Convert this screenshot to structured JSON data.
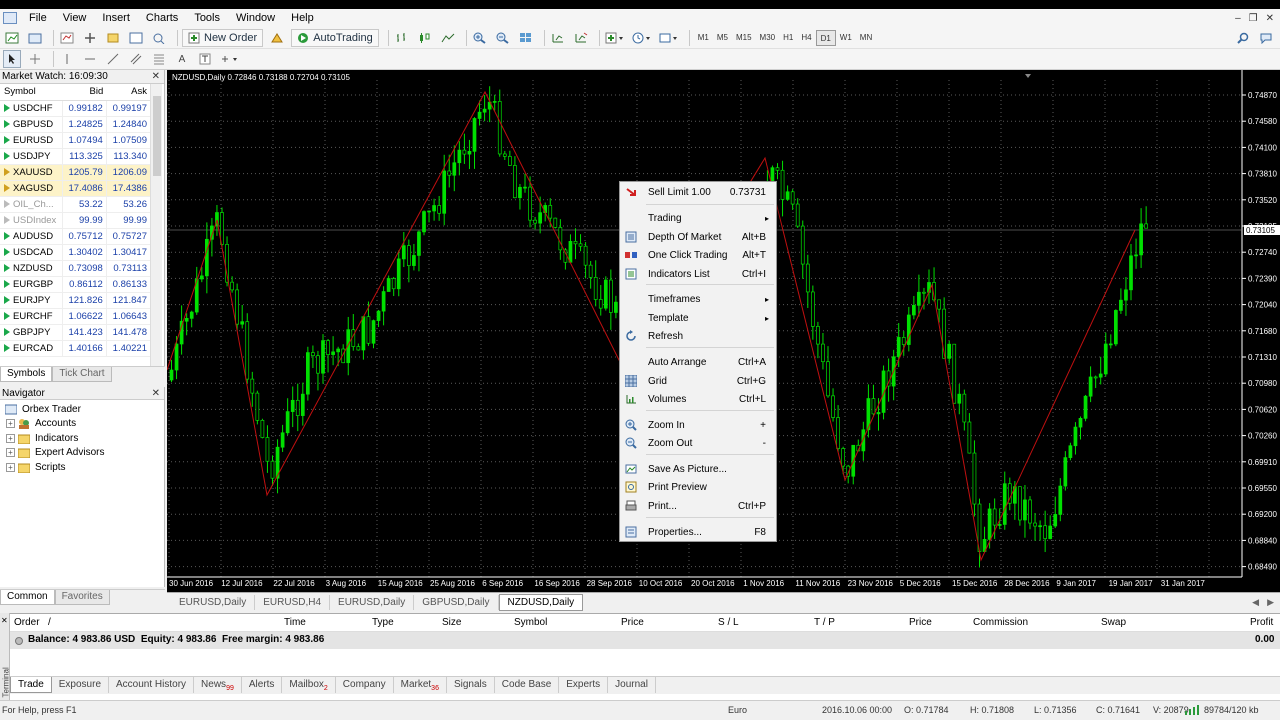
{
  "menu": {
    "items": [
      "File",
      "View",
      "Insert",
      "Charts",
      "Tools",
      "Window",
      "Help"
    ]
  },
  "toolbar": {
    "new_order": "New Order",
    "autotrading": "AutoTrading",
    "timeframes": [
      "M1",
      "M5",
      "M15",
      "M30",
      "H1",
      "H4",
      "D1",
      "W1",
      "MN"
    ],
    "selected_timeframe": "D1"
  },
  "market_watch": {
    "title": "Market Watch: 16:09:30",
    "columns": [
      "Symbol",
      "Bid",
      "Ask"
    ],
    "rows": [
      {
        "symbol": "USDCHF",
        "bid": "0.99182",
        "ask": "0.99197",
        "state": "normal"
      },
      {
        "symbol": "GBPUSD",
        "bid": "1.24825",
        "ask": "1.24840",
        "state": "normal"
      },
      {
        "symbol": "EURUSD",
        "bid": "1.07494",
        "ask": "1.07509",
        "state": "normal"
      },
      {
        "symbol": "USDJPY",
        "bid": "113.325",
        "ask": "113.340",
        "state": "normal"
      },
      {
        "symbol": "XAUUSD",
        "bid": "1205.79",
        "ask": "1206.09",
        "state": "highlight"
      },
      {
        "symbol": "XAGUSD",
        "bid": "17.4086",
        "ask": "17.4386",
        "state": "highlight"
      },
      {
        "symbol": "OIL_Ch...",
        "bid": "53.22",
        "ask": "53.26",
        "state": "dim"
      },
      {
        "symbol": "USDIndex",
        "bid": "99.99",
        "ask": "99.99",
        "state": "dim"
      },
      {
        "symbol": "AUDUSD",
        "bid": "0.75712",
        "ask": "0.75727",
        "state": "normal"
      },
      {
        "symbol": "USDCAD",
        "bid": "1.30402",
        "ask": "1.30417",
        "state": "normal"
      },
      {
        "symbol": "NZDUSD",
        "bid": "0.73098",
        "ask": "0.73113",
        "state": "normal"
      },
      {
        "symbol": "EURGBP",
        "bid": "0.86112",
        "ask": "0.86133",
        "state": "normal"
      },
      {
        "symbol": "EURJPY",
        "bid": "121.826",
        "ask": "121.847",
        "state": "normal"
      },
      {
        "symbol": "EURCHF",
        "bid": "1.06622",
        "ask": "1.06643",
        "state": "normal"
      },
      {
        "symbol": "GBPJPY",
        "bid": "141.423",
        "ask": "141.478",
        "state": "normal"
      },
      {
        "symbol": "EURCAD",
        "bid": "1.40166",
        "ask": "1.40221",
        "state": "normal"
      }
    ],
    "tabs": [
      "Symbols",
      "Tick Chart"
    ]
  },
  "navigator": {
    "title": "Navigator",
    "root": "Orbex Trader",
    "items": [
      "Accounts",
      "Indicators",
      "Expert Advisors",
      "Scripts"
    ],
    "tabs": [
      "Common",
      "Favorites"
    ]
  },
  "chart": {
    "title": "NZDUSD,Daily  0.72846 0.73188 0.72704 0.73105",
    "price_labels": [
      "0.74870",
      "0.74580",
      "0.74100",
      "0.73810",
      "0.73520",
      "0.73105",
      "0.72740",
      "0.72390",
      "0.72040",
      "0.71680",
      "0.71310",
      "0.70980",
      "0.70620",
      "0.70260",
      "0.69910",
      "0.69550",
      "0.69200",
      "0.68840",
      "0.68490"
    ],
    "date_labels": [
      "30 Jun 2016",
      "12 Jul 2016",
      "22 Jul 2016",
      "3 Aug 2016",
      "15 Aug 2016",
      "25 Aug 2016",
      "6 Sep 2016",
      "16 Sep 2016",
      "28 Sep 2016",
      "10 Oct 2016",
      "20 Oct 2016",
      "1 Nov 2016",
      "11 Nov 2016",
      "23 Nov 2016",
      "5 Dec 2016",
      "15 Dec 2016",
      "28 Dec 2016",
      "9 Jan 2017",
      "19 Jan 2017",
      "31 Jan 2017"
    ],
    "colors": {
      "bull": "#00e000",
      "bear": "#000000",
      "wick": "#00e000",
      "zigzag": "#c01010",
      "grid": "#5a5a5a"
    },
    "current_price": "0.73105"
  },
  "chart_tabs": [
    "EURUSD,Daily",
    "EURUSD,H4",
    "EURUSD,Daily",
    "GBPUSD,Daily",
    "NZDUSD,Daily"
  ],
  "active_chart_tab": "NZDUSD,Daily",
  "context_menu": {
    "items": [
      {
        "label": "Sell Limit 1.00",
        "shortcut": "0.73731",
        "icon": "sell-limit-icon",
        "sub": false
      },
      {
        "label": "Trading",
        "shortcut": "",
        "icon": "",
        "sub": true
      },
      {
        "label": "Depth Of Market",
        "shortcut": "Alt+B",
        "icon": "depth-of-market-icon",
        "sub": false
      },
      {
        "label": "One Click Trading",
        "shortcut": "Alt+T",
        "icon": "one-click-trading-icon",
        "sub": false
      },
      {
        "label": "Indicators List",
        "shortcut": "Ctrl+I",
        "icon": "indicators-list-icon",
        "sub": false
      },
      {
        "label": "Timeframes",
        "shortcut": "",
        "icon": "",
        "sub": true
      },
      {
        "label": "Template",
        "shortcut": "",
        "icon": "",
        "sub": true
      },
      {
        "label": "Refresh",
        "shortcut": "",
        "icon": "refresh-icon",
        "sub": false
      },
      {
        "label": "Auto Arrange",
        "shortcut": "Ctrl+A",
        "icon": "",
        "sub": false
      },
      {
        "label": "Grid",
        "shortcut": "Ctrl+G",
        "icon": "grid-icon",
        "sub": false
      },
      {
        "label": "Volumes",
        "shortcut": "Ctrl+L",
        "icon": "volumes-icon",
        "sub": false
      },
      {
        "label": "Zoom In",
        "shortcut": "+",
        "icon": "zoom-in-icon",
        "sub": false
      },
      {
        "label": "Zoom Out",
        "shortcut": "-",
        "icon": "zoom-out-icon",
        "sub": false
      },
      {
        "label": "Save As Picture...",
        "shortcut": "",
        "icon": "save-picture-icon",
        "sub": false
      },
      {
        "label": "Print Preview",
        "shortcut": "",
        "icon": "print-preview-icon",
        "sub": false
      },
      {
        "label": "Print...",
        "shortcut": "Ctrl+P",
        "icon": "print-icon",
        "sub": false
      },
      {
        "label": "Properties...",
        "shortcut": "F8",
        "icon": "properties-icon",
        "sub": false
      }
    ]
  },
  "terminal": {
    "side_label": "Terminal",
    "columns": [
      "Order",
      "/",
      "Time",
      "Type",
      "Size",
      "Symbol",
      "Price",
      "S / L",
      "T / P",
      "Price",
      "Commission",
      "Swap",
      "Profit"
    ],
    "balance_text": "Balance: 4 983.86 USD  Equity: 4 983.86  Free margin: 4 983.86",
    "profit_total": "0.00",
    "tabs": [
      {
        "label": "Trade",
        "badge": ""
      },
      {
        "label": "Exposure",
        "badge": ""
      },
      {
        "label": "Account History",
        "badge": ""
      },
      {
        "label": "News",
        "badge": "99"
      },
      {
        "label": "Alerts",
        "badge": ""
      },
      {
        "label": "Mailbox",
        "badge": "2"
      },
      {
        "label": "Company",
        "badge": ""
      },
      {
        "label": "Market",
        "badge": "36"
      },
      {
        "label": "Signals",
        "badge": ""
      },
      {
        "label": "Code Base",
        "badge": ""
      },
      {
        "label": "Experts",
        "badge": ""
      },
      {
        "label": "Journal",
        "badge": ""
      }
    ]
  },
  "status_bar": {
    "help": "For Help, press F1",
    "profile": "Euro",
    "datetime": "2016.10.06 00:00",
    "open": "O: 0.71784",
    "high": "H: 0.71808",
    "low": "L: 0.71356",
    "close": "C: 0.71641",
    "volume": "V: 20879",
    "traffic": "89784/120 kb"
  }
}
